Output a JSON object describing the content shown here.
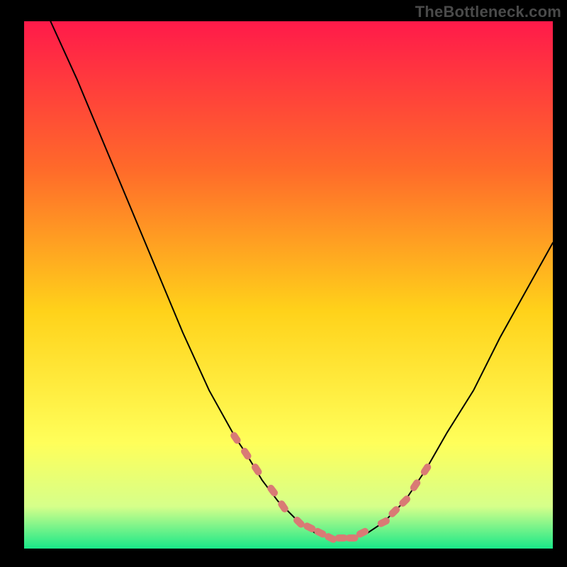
{
  "watermark": "TheBottleneck.com",
  "colors": {
    "frame": "#000000",
    "gradient_top": "#ff1a4a",
    "gradient_mid1": "#ff6a2a",
    "gradient_mid2": "#ffd21a",
    "gradient_mid3": "#ffff5a",
    "gradient_bottom_fade": "#d6ff8a",
    "gradient_bottom": "#19e889",
    "curve": "#000000",
    "markers": "#d97a75"
  },
  "chart_data": {
    "type": "line",
    "title": "",
    "xlabel": "",
    "ylabel": "",
    "xlim": [
      0,
      100
    ],
    "ylim": [
      0,
      100
    ],
    "series": [
      {
        "name": "bottleneck-curve",
        "x": [
          5,
          10,
          15,
          20,
          25,
          30,
          35,
          40,
          42,
          45,
          48,
          52,
          55,
          58,
          62,
          65,
          68,
          72,
          76,
          80,
          85,
          90,
          95,
          100
        ],
        "values": [
          100,
          89,
          77,
          65,
          53,
          41,
          30,
          21,
          18,
          13,
          9,
          5,
          3,
          2,
          2,
          3,
          5,
          9,
          15,
          22,
          30,
          40,
          49,
          58
        ]
      }
    ],
    "markers": {
      "name": "highlighted-points",
      "x": [
        40,
        42,
        44,
        47,
        49,
        52,
        54,
        56,
        58,
        60,
        62,
        64,
        68,
        70,
        72,
        74,
        76
      ],
      "values": [
        21,
        18,
        15,
        11,
        8,
        5,
        4,
        3,
        2,
        2,
        2,
        3,
        5,
        7,
        9,
        12,
        15
      ]
    }
  }
}
